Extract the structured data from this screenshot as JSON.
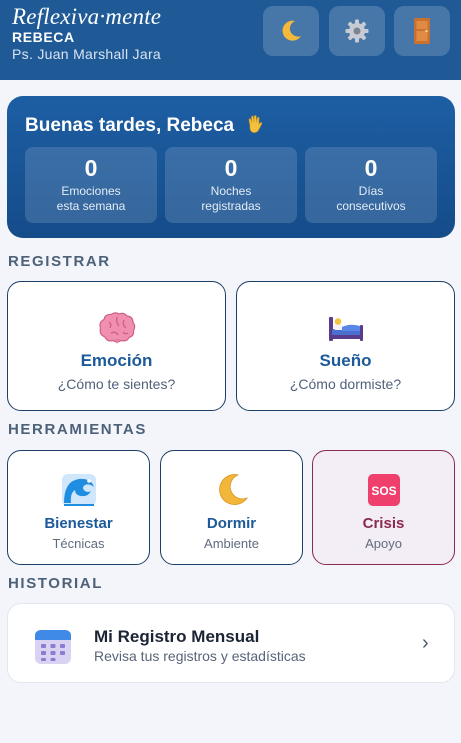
{
  "header": {
    "brand_name": "Reflexiva·mente",
    "patient_name": "REBECA",
    "therapist": "Ps. Juan Marshall Jara",
    "icons": [
      "crescent-moon-icon",
      "gear-icon",
      "door-icon"
    ]
  },
  "welcome": {
    "greeting": "Buenas tardes, Rebeca",
    "greeting_icon": "waving-hand-icon",
    "stats": [
      {
        "value": "0",
        "label": "Emociones\nesta semana"
      },
      {
        "value": "0",
        "label": "Noches\nregistradas"
      },
      {
        "value": "0",
        "label": "Días\nconsecutivos"
      }
    ]
  },
  "sections": {
    "register": "REGISTRAR",
    "tools": "HERRAMIENTAS",
    "history": "HISTORIAL"
  },
  "register_cards": [
    {
      "title": "Emoción",
      "subtitle": "¿Cómo te sientes?",
      "icon": "brain-icon"
    },
    {
      "title": "Sueño",
      "subtitle": "¿Cómo dormiste?",
      "icon": "bed-icon"
    }
  ],
  "tool_cards": [
    {
      "title": "Bienestar",
      "subtitle": "Técnicas",
      "icon": "wave-icon"
    },
    {
      "title": "Dormir",
      "subtitle": "Ambiente",
      "icon": "crescent-moon-icon"
    },
    {
      "title": "Crisis",
      "subtitle": "Apoyo",
      "icon": "sos-icon",
      "badge": "SOS"
    }
  ],
  "history_item": {
    "title": "Mi Registro Mensual",
    "subtitle": "Revisa tus registros y estadísticas",
    "icon": "calendar-icon"
  },
  "colors": {
    "header_bg": "#1f5a96",
    "primary": "#1d5a99",
    "crisis": "#8b2a55",
    "page_bg": "#f3f5fa"
  }
}
